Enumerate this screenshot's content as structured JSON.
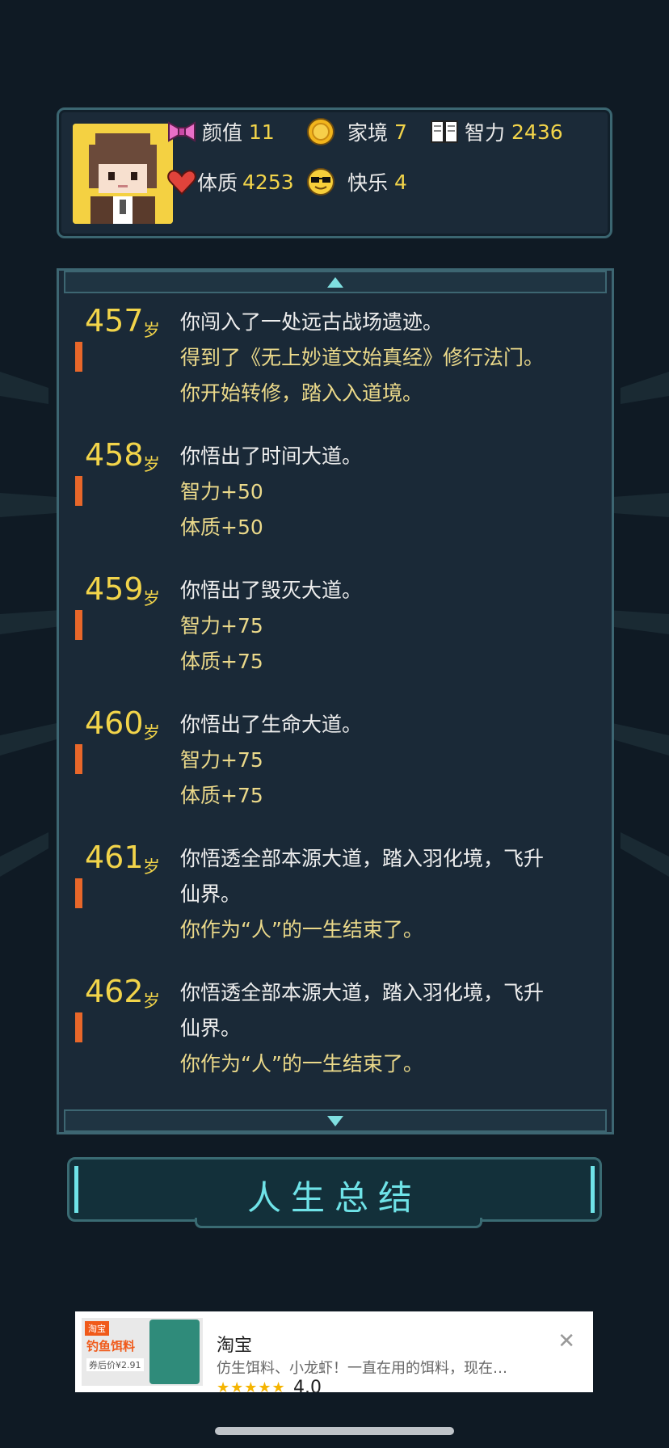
{
  "stats": {
    "appearance": {
      "label": "颜值",
      "value": "11",
      "icon": "bow-icon"
    },
    "family": {
      "label": "家境",
      "value": "7",
      "icon": "coin-icon"
    },
    "intelligence": {
      "label": "智力",
      "value": "2436",
      "icon": "book-icon"
    },
    "physique": {
      "label": "体质",
      "value": "4253",
      "icon": "heart-icon"
    },
    "happiness": {
      "label": "快乐",
      "value": "4",
      "icon": "sunglasses-icon"
    }
  },
  "events": [
    {
      "age": "457",
      "unit": "岁",
      "lines": [
        {
          "text": "你闯入了一处远古战场遗迹。",
          "color": "white"
        },
        {
          "text": "得到了《无上妙道文始真经》修行法门。",
          "color": "yellow"
        },
        {
          "text": "你开始转修，踏入入道境。",
          "color": "yellow"
        }
      ]
    },
    {
      "age": "458",
      "unit": "岁",
      "lines": [
        {
          "text": "你悟出了时间大道。",
          "color": "white"
        },
        {
          "text": "智力+50",
          "color": "yellow"
        },
        {
          "text": "体质+50",
          "color": "yellow"
        }
      ]
    },
    {
      "age": "459",
      "unit": "岁",
      "lines": [
        {
          "text": "你悟出了毁灭大道。",
          "color": "white"
        },
        {
          "text": "智力+75",
          "color": "yellow"
        },
        {
          "text": "体质+75",
          "color": "yellow"
        }
      ]
    },
    {
      "age": "460",
      "unit": "岁",
      "lines": [
        {
          "text": "你悟出了生命大道。",
          "color": "white"
        },
        {
          "text": "智力+75",
          "color": "yellow"
        },
        {
          "text": "体质+75",
          "color": "yellow"
        }
      ]
    },
    {
      "age": "461",
      "unit": "岁",
      "lines": [
        {
          "text": "你悟透全部本源大道，踏入羽化境，飞升",
          "color": "white"
        },
        {
          "text": "仙界。",
          "color": "white"
        },
        {
          "text": "你作为“人”的一生结束了。",
          "color": "yellow"
        }
      ]
    },
    {
      "age": "462",
      "unit": "岁",
      "lines": [
        {
          "text": "你悟透全部本源大道，踏入羽化境，飞升",
          "color": "white"
        },
        {
          "text": "仙界。",
          "color": "white"
        },
        {
          "text": "你作为“人”的一生结束了。",
          "color": "yellow"
        }
      ]
    }
  ],
  "summary_button": {
    "label": "人生总结"
  },
  "ad": {
    "thumb_tag": "淘宝",
    "thumb_text": "钓鱼饵料",
    "thumb_price": "券后价¥2.91",
    "title": "淘宝",
    "description": "仿生饵料、小龙虾！一直在用的饵料，现在…",
    "stars": "★★★★★",
    "rating": "4.0",
    "close_glyph": "✕"
  },
  "colors": {
    "background": "#0f1a24",
    "accent_cyan": "#6fe3e8",
    "value_yellow": "#f2d44a",
    "age_bar": "#e8672a"
  }
}
